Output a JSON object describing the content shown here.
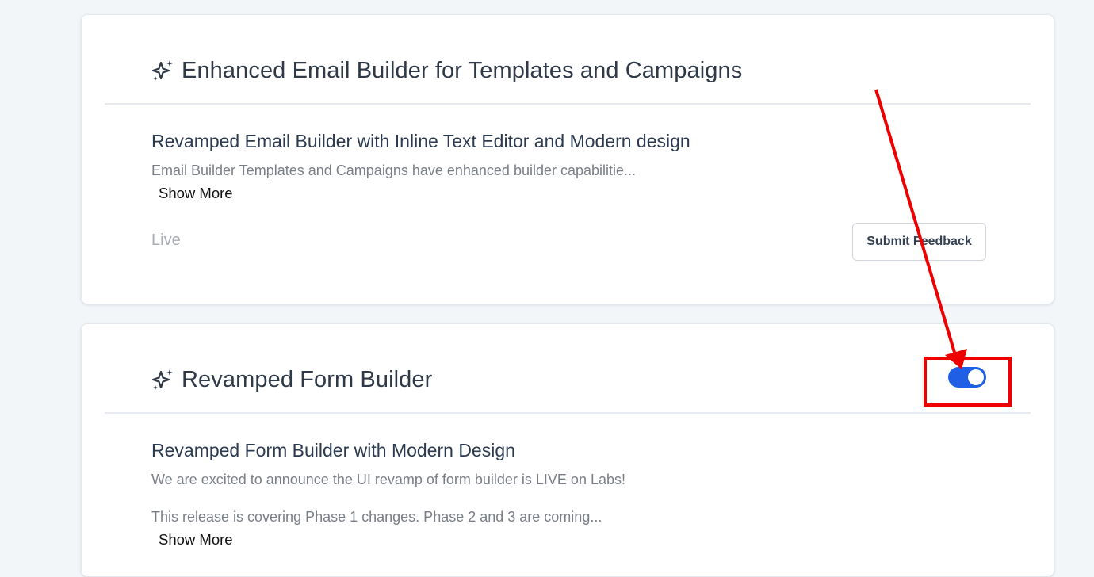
{
  "cards": [
    {
      "title": "Enhanced Email Builder for Templates and Campaigns",
      "icon": "sparkle-icon",
      "feature_title": "Revamped Email Builder with Inline Text Editor and Modern design",
      "description": "Email Builder Templates and Campaigns have enhanced builder capabilitie...",
      "show_more_label": "Show More",
      "status": "Live",
      "feedback_label": "Submit Feedback"
    },
    {
      "title": "Revamped Form Builder",
      "icon": "sparkle-icon",
      "toggle_state": "on",
      "feature_title": "Revamped Form Builder with Modern Design",
      "description_lines": [
        "We are excited to announce the UI revamp of form builder is LIVE on Labs!",
        "This release is covering Phase 1 changes. Phase 2 and 3 are coming..."
      ],
      "show_more_label": "Show More"
    }
  ],
  "colors": {
    "page_background": "#f2f6f9",
    "toggle_on": "#1f5fe6",
    "annotation": "#ee0000"
  }
}
